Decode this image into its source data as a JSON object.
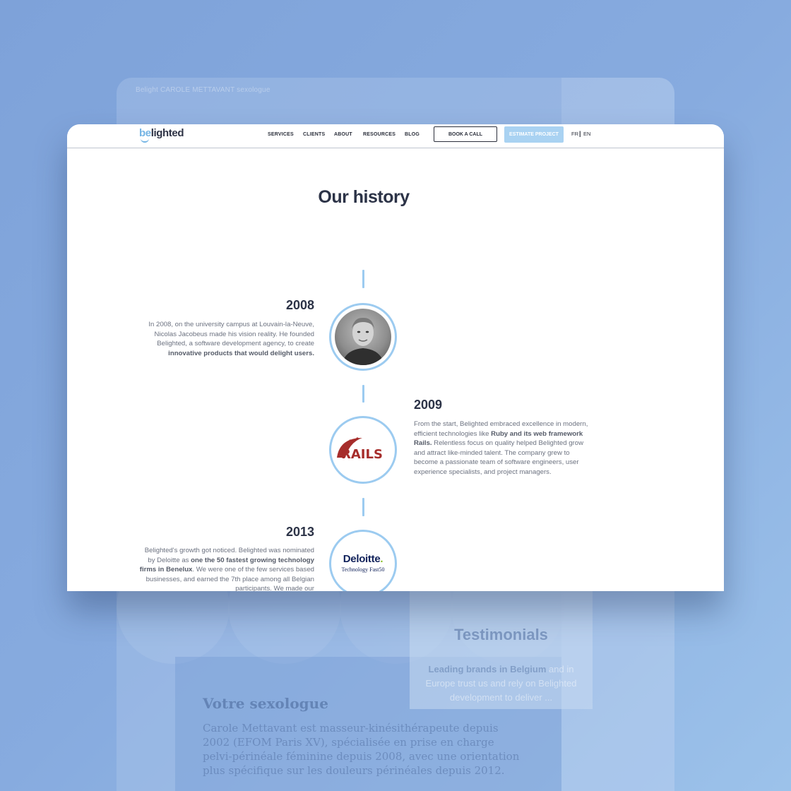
{
  "background": {
    "breadcrumb": "Belight  CAROLE METTAVANT  sexologue",
    "testimonials": {
      "title": "Testimonials",
      "text_bold": "Leading brands in Belgium",
      "text_rest": " and in Europe trust us and rely on Belighted development to deliver ..."
    },
    "lower_section": {
      "heading": "Votre sexologue",
      "paragraph": "Carole Mettavant est masseur-kinésithérapeute depuis 2002 (EFOM Paris XV), spécialisée en prise en charge pelvi-périnéale féminine depuis 2008, avec une orientation plus spécifique sur les douleurs périnéales depuis 2012."
    }
  },
  "navbar": {
    "logo_prefix": "be",
    "logo_suffix": "lighted",
    "links": [
      "SERVICES",
      "CLIENTS",
      "ABOUT",
      "RESOURCES",
      "BLOG"
    ],
    "book_call": "BOOK A CALL",
    "estimate_project": "ESTIMATE PROJECT",
    "lang_fr": "FR",
    "lang_separator": "|",
    "lang_en": "EN"
  },
  "page": {
    "title": "Our history"
  },
  "timeline": [
    {
      "year": "2008",
      "text_plain": "In 2008, on the university campus at Louvain-la-Neuve, Nicolas Jacobeus made his vision reality. He founded Belighted, a software development agency, to create ",
      "text_bold": "innovative products that would delight users."
    },
    {
      "year": "2009",
      "text_plain_1": "From the start, Belighted embraced excellence in modern, efficient technologies like ",
      "text_bold": "Ruby and its web framework Rails.",
      "text_plain_2": " Relentless focus on quality helped Belighted grow and attract like-minded talent. The company grew to become a passionate team of software engineers, user experience specialists, and project managers.",
      "logo_text": "RAILS"
    },
    {
      "year": "2013",
      "text_plain_1": "Belighted's growth got noticed. Belighted was nominated by Deloitte as ",
      "text_bold": "one the 50 fastest growing technology firms in Benelux",
      "text_plain_2": ". We were one of the few services based businesses, and earned the 7th place among all Belgian participants. We made our",
      "logo_text": "Deloitte",
      "logo_dot": ".",
      "logo_sub": "Technology Fast50"
    }
  ],
  "colors": {
    "accent_blue": "#9ccbf0",
    "estimate_button": "#a9d2f2",
    "heading": "#2c3347",
    "rails_red": "#a62d2b",
    "deloitte_navy": "#10215a",
    "deloitte_green": "#86bc25"
  }
}
